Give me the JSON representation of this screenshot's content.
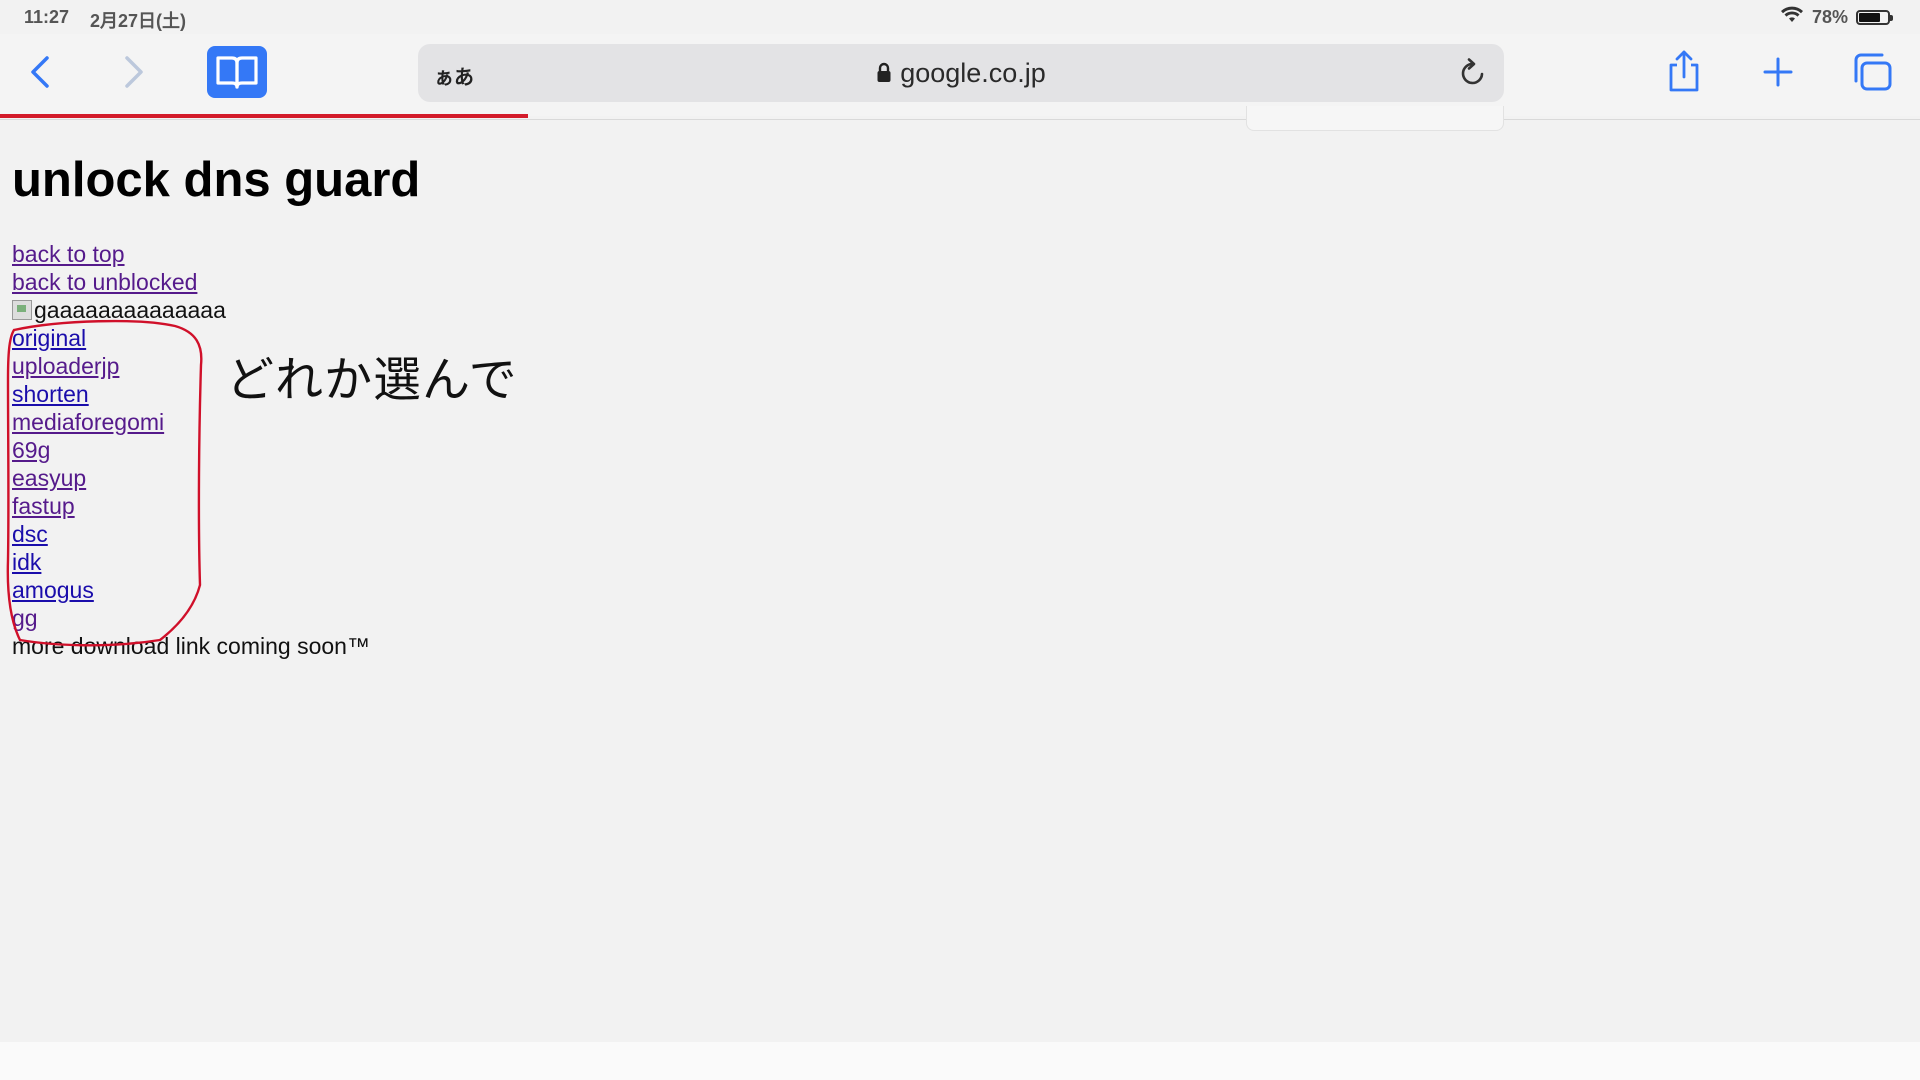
{
  "status_bar": {
    "time": "11:27",
    "date": "2月27日(土)",
    "battery_percent": "78%",
    "battery_level": 0.78
  },
  "toolbar": {
    "text_size_label": "ぁあ",
    "url": "google.co.jp",
    "accent_color": "#3478f6",
    "progress_color": "#d31b2a",
    "load_progress": 0.275
  },
  "page": {
    "title": "unlock dns guard",
    "nav_links": [
      {
        "label": "back to top"
      },
      {
        "label": "back to unblocked"
      }
    ],
    "image_alt": "gaaaaaaaaaaaaaa",
    "download_links": [
      {
        "label": "original",
        "visited": false
      },
      {
        "label": "uploaderjp",
        "visited": true
      },
      {
        "label": "shorten",
        "visited": false
      },
      {
        "label": "mediaforegomi",
        "visited": true
      },
      {
        "label": "69g",
        "visited": true
      },
      {
        "label": "easyup",
        "visited": true
      },
      {
        "label": "fastup",
        "visited": true
      },
      {
        "label": "dsc",
        "visited": false
      },
      {
        "label": "idk",
        "visited": false
      },
      {
        "label": "amogus",
        "visited": false
      },
      {
        "label": "gg",
        "visited": true
      }
    ],
    "footer_text": "more download link coming soon™"
  },
  "annotation": {
    "text": "どれか選んで",
    "color": "#d0102a"
  }
}
